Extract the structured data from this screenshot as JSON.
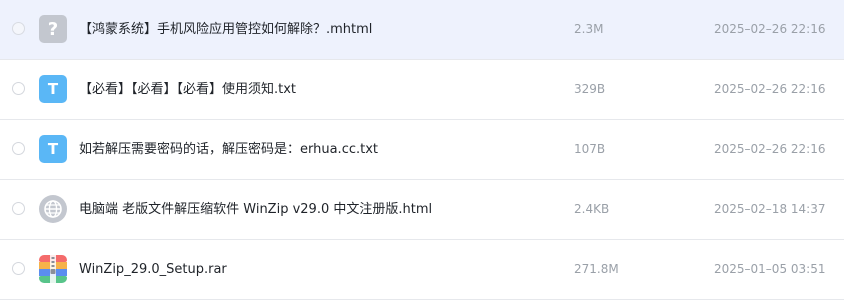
{
  "files": [
    {
      "name": "【鸿蒙系统】手机风险应用管控如何解除？.mhtml",
      "size": "2.3M",
      "date": "2025–02–26 22:16",
      "icon": "unknown-file-icon",
      "icon_glyph": "?",
      "selected": true
    },
    {
      "name": "【必看】【必看】【必看】使用须知.txt",
      "size": "329B",
      "date": "2025–02–26 22:16",
      "icon": "text-file-icon",
      "icon_glyph": "T",
      "selected": false
    },
    {
      "name": "如若解压需要密码的话，解压密码是：erhua.cc.txt",
      "size": "107B",
      "date": "2025–02–26 22:16",
      "icon": "text-file-icon",
      "icon_glyph": "T",
      "selected": false
    },
    {
      "name": "电脑端 老版文件解压缩软件 WinZip v29.0 中文注册版.html",
      "size": "2.4KB",
      "date": "2025–02–18 14:37",
      "icon": "globe-icon",
      "selected": false
    },
    {
      "name": "WinZip_29.0_Setup.rar",
      "size": "271.8M",
      "date": "2025–01–05 03:51",
      "icon": "archive-icon",
      "selected": false
    }
  ],
  "colors": {
    "selected_row": "#eef2fd",
    "text_icon": "#5ab7f6",
    "unknown_icon": "#c3c7cf",
    "meta_text": "#9aa0a8"
  }
}
